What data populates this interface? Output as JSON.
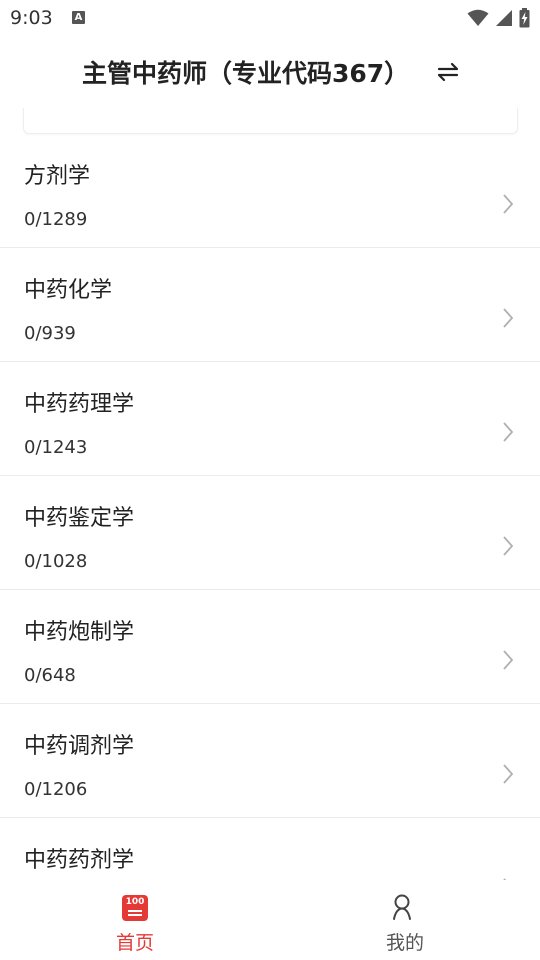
{
  "status_bar": {
    "time": "9:03",
    "notification_icon": "a-icon",
    "wifi_icon": "wifi-icon",
    "signal_icon": "signal-icon",
    "battery_icon": "battery-charging-icon"
  },
  "header": {
    "title": "主管中药师（专业代码367）",
    "switch_icon": "switch-arrows-icon"
  },
  "subjects": [
    {
      "name": "方剂学",
      "progress": "0/1289"
    },
    {
      "name": "中药化学",
      "progress": "0/939"
    },
    {
      "name": "中药药理学",
      "progress": "0/1243"
    },
    {
      "name": "中药鉴定学",
      "progress": "0/1028"
    },
    {
      "name": "中药炮制学",
      "progress": "0/648"
    },
    {
      "name": "中药调剂学",
      "progress": "0/1206"
    },
    {
      "name": "中药药剂学",
      "progress": ""
    }
  ],
  "bottom_nav": {
    "home": {
      "label": "首页",
      "icon": "home-100-icon",
      "icon_text": "100",
      "active": true
    },
    "mine": {
      "label": "我的",
      "icon": "person-icon",
      "active": false
    }
  },
  "colors": {
    "accent": "#e53935",
    "text": "#222222",
    "divider": "#ececec",
    "chevron": "#b0b0b0"
  }
}
